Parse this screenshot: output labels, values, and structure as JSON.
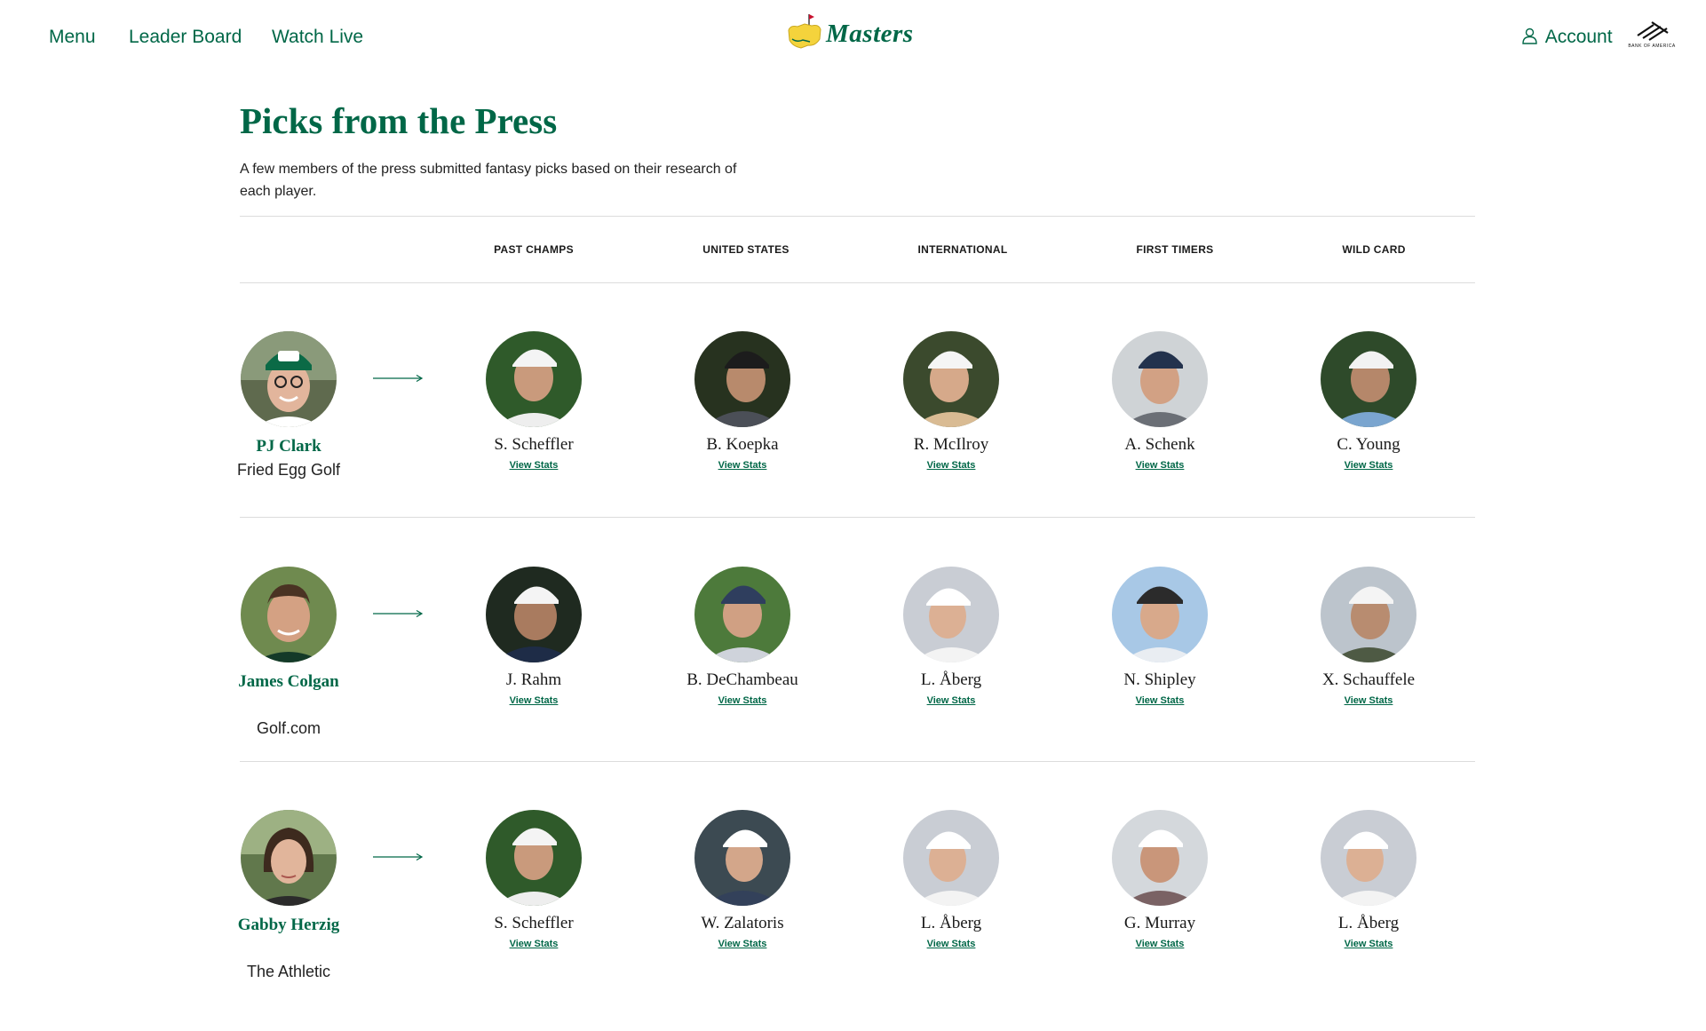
{
  "header": {
    "nav": [
      "Menu",
      "Leader Board",
      "Watch Live"
    ],
    "logo_text": "Masters",
    "account_label": "Account",
    "sponsor_text": "BANK OF AMERICA"
  },
  "page": {
    "title": "Picks from the Press",
    "description": "A few members of the press submitted fantasy picks based on their research of each player."
  },
  "columns": [
    "PAST CHAMPS",
    "UNITED STATES",
    "INTERNATIONAL",
    "FIRST TIMERS",
    "WILD CARD"
  ],
  "view_stats_label": "View Stats",
  "colors": {
    "brand_green": "#006747",
    "logo_yellow": "#f4d33c"
  },
  "rows": [
    {
      "press": {
        "name": "PJ Clark",
        "outlet": "Fried Egg Golf"
      },
      "picks": [
        "S. Scheffler",
        "B. Koepka",
        "R. McIlroy",
        "A. Schenk",
        "C. Young"
      ]
    },
    {
      "press": {
        "name": "James Colgan",
        "outlet": "Golf.com"
      },
      "picks": [
        "J. Rahm",
        "B. DeChambeau",
        "L. Åberg",
        "N. Shipley",
        "X. Schauffele"
      ]
    },
    {
      "press": {
        "name": "Gabby Herzig",
        "outlet": "The Athletic"
      },
      "picks": [
        "S. Scheffler",
        "W. Zalatoris",
        "L. Åberg",
        "G. Murray",
        "L. Åberg"
      ]
    }
  ]
}
